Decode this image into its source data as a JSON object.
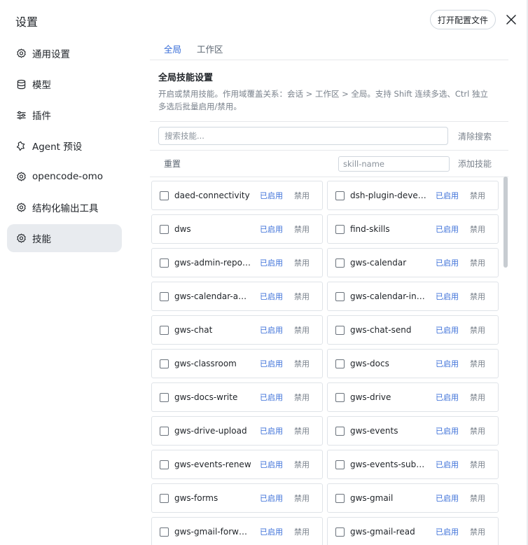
{
  "dialog": {
    "title": "设置",
    "open_config_label": "打开配置文件"
  },
  "sidebar": {
    "items": [
      {
        "label": "通用设置",
        "icon": "gear-icon"
      },
      {
        "label": "模型",
        "icon": "database-icon"
      },
      {
        "label": "插件",
        "icon": "sliders-icon"
      },
      {
        "label": "Agent 预设",
        "icon": "agent-icon"
      },
      {
        "label": "opencode-omo",
        "icon": "gear-icon"
      },
      {
        "label": "结构化输出工具",
        "icon": "gear-icon"
      },
      {
        "label": "技能",
        "icon": "gear-icon",
        "active": true
      }
    ]
  },
  "tabs": [
    {
      "label": "全局",
      "active": true
    },
    {
      "label": "工作区"
    }
  ],
  "section": {
    "title": "全局技能设置",
    "description": "开启或禁用技能。作用域覆盖关系：会话 > 工作区 > 全局。支持 Shift 连续多选、Ctrl 独立多选后批量启用/禁用。"
  },
  "search": {
    "placeholder": "搜索技能...",
    "clear_label": "清除搜索"
  },
  "actions": {
    "reset_label": "重置",
    "skill_name_placeholder": "skill-name",
    "add_label": "添加技能"
  },
  "skill_buttons": {
    "enabled": "已启用",
    "disabled": "禁用"
  },
  "skills": [
    "daed-connectivity",
    "dsh-plugin-develo...",
    "dws",
    "find-skills",
    "gws-admin-reports",
    "gws-calendar",
    "gws-calendar-age...",
    "gws-calendar-insert",
    "gws-chat",
    "gws-chat-send",
    "gws-classroom",
    "gws-docs",
    "gws-docs-write",
    "gws-drive",
    "gws-drive-upload",
    "gws-events",
    "gws-events-renew",
    "gws-events-subscr...",
    "gws-forms",
    "gws-gmail",
    "gws-gmail-forward",
    "gws-gmail-read"
  ],
  "colors": {
    "accent": "#3b6fd8",
    "muted": "#7a828c",
    "active_bg": "#e8ebef",
    "border": "#dfe3e8"
  }
}
